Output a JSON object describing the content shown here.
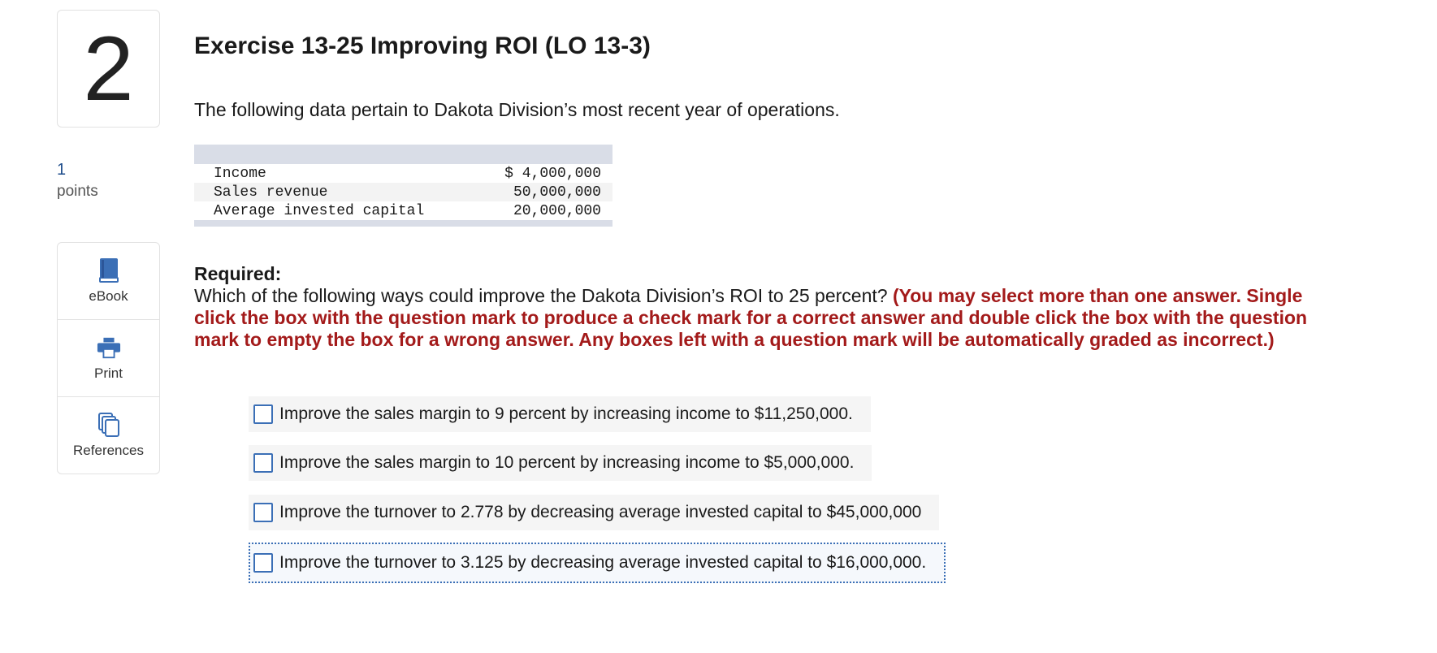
{
  "question": {
    "number": "2",
    "points_value": "1",
    "points_label": "points"
  },
  "tools": [
    {
      "label": "eBook",
      "icon": "book-icon"
    },
    {
      "label": "Print",
      "icon": "printer-icon"
    },
    {
      "label": "References",
      "icon": "documents-icon"
    }
  ],
  "exercise": {
    "title": "Exercise 13-25 Improving ROI (LO 13-3)",
    "intro": "The following data pertain to Dakota Division’s most recent year of operations."
  },
  "data_table": {
    "rows": [
      {
        "label": "Income",
        "value": "$ 4,000,000"
      },
      {
        "label": "Sales revenue",
        "value": "50,000,000"
      },
      {
        "label": "Average invested capital",
        "value": "20,000,000"
      }
    ]
  },
  "required": {
    "heading": "Required:",
    "question": "Which of the following ways could improve the Dakota Division’s ROI to 25 percent?",
    "instruction": "(You may select more than one answer. Single click the box with the question mark to produce a check mark for a correct answer and double click the box with the question mark to empty the box for a wrong answer. Any boxes left with a question mark will be automatically graded as incorrect.)"
  },
  "answers": [
    {
      "text": "Improve the sales margin to 9 percent by increasing income to $11,250,000.",
      "checked": false
    },
    {
      "text": "Improve the sales margin to 10 percent by increasing income to $5,000,000.",
      "checked": false
    },
    {
      "text": "Improve the turnover to 2.778 by decreasing average invested capital to $45,000,000",
      "checked": false
    },
    {
      "text": "Improve the turnover to 3.125 by decreasing average invested capital to $16,000,000.",
      "checked": false
    }
  ],
  "colors": {
    "accent": "#3b6fb6",
    "instruction_red": "#a31a1a",
    "table_band": "#d9dde7"
  }
}
